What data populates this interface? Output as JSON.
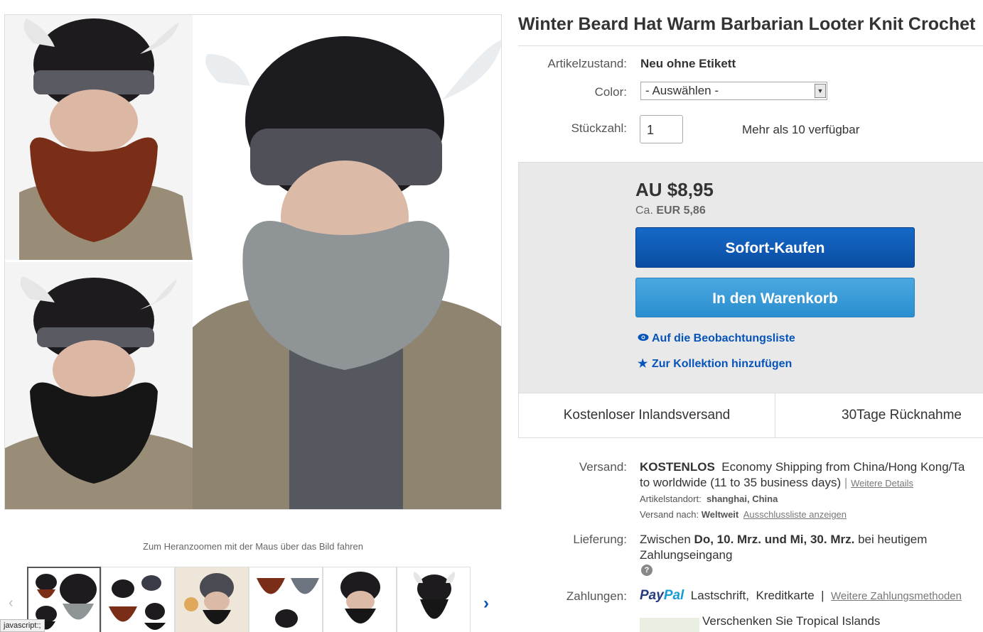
{
  "gallery": {
    "zoom_hint": "Zum Heranzoomen mit der Maus über das Bild fahren",
    "thumbnail_count": 6,
    "prev_glyph": "‹",
    "next_glyph": "›"
  },
  "status_bar": "javascript:;",
  "listing": {
    "title": "Winter Beard Hat Warm Barbarian Looter Knit Crochet",
    "condition_label": "Artikelzustand:",
    "condition_value": "Neu ohne Etikett",
    "color_label": "Color:",
    "color_selected": "- Auswählen -",
    "qty_label": "Stückzahl:",
    "qty_value": "1",
    "qty_available": "Mehr als 10 verfügbar"
  },
  "buybox": {
    "price": "AU $8,95",
    "price_converted_prefix": "Ca.",
    "price_converted_value": "EUR 5,86",
    "buy_now": "Sofort-Kaufen",
    "add_to_cart": "In den Warenkorb",
    "watchlist": "Auf die Beobachtungsliste",
    "collection": "Zur Kollektion hinzufügen",
    "feature_1": "Kostenloser Inlandsversand",
    "feature_2": "30Tage Rücknahme"
  },
  "shipping": {
    "label": "Versand:",
    "free": "KOSTENLOS",
    "service": "Economy Shipping from China/Hong Kong/Ta",
    "service_line2": "to worldwide (11 to 35 business days)",
    "separator": "|",
    "more_details": "Weitere Details",
    "location_label": "Artikelstandort:",
    "location_value": "shanghai, China",
    "ships_to_label": "Versand nach:",
    "ships_to_value": "Weltweit",
    "exclusions_link": "Ausschlussliste anzeigen"
  },
  "delivery": {
    "label": "Lieferung:",
    "prefix": "Zwischen",
    "date_1": "Do, 10. Mrz.",
    "and": "und",
    "date_2": "Mi, 30. Mrz.",
    "suffix": "bei heutigem",
    "line2": "Zahlungseingang",
    "info_glyph": "?"
  },
  "payments": {
    "label": "Zahlungen:",
    "paypal_1": "Pay",
    "paypal_2": "Pal",
    "method_2": "Lastschrift,",
    "method_3": "Kreditkarte",
    "separator": "|",
    "more_methods": "Weitere Zahlungsmethoden"
  },
  "gift": {
    "text": "Verschenken Sie Tropical Islands"
  },
  "colors": {
    "buy_button": "#0654ba",
    "cart_button": "#2a8ecf",
    "link": "#0654ba",
    "buybox_bg": "#e9e9e9"
  },
  "icons": [
    "eye-icon",
    "star-icon",
    "chevron-left-icon",
    "chevron-right-icon",
    "dropdown-arrow-icon",
    "info-icon"
  ]
}
